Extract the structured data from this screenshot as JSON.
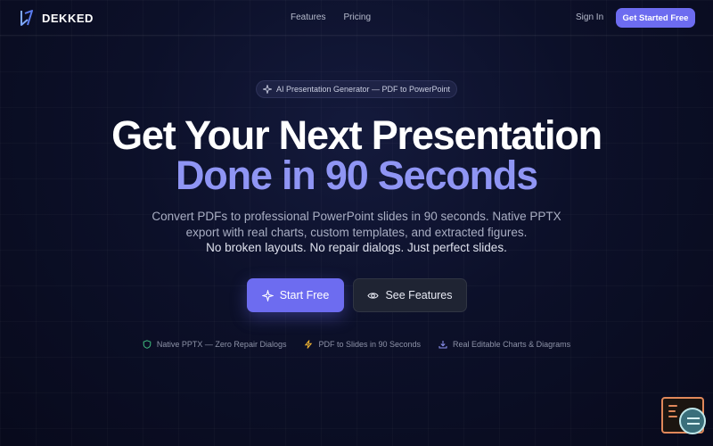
{
  "nav": {
    "brand": "DEKKED",
    "links": [
      "Features",
      "Pricing"
    ],
    "sign_in": "Sign In",
    "cta": "Get Started Free"
  },
  "hero": {
    "badge_icon": "sparkles-icon",
    "badge": "AI Presentation Generator — PDF to PowerPoint",
    "title_line1": "Get Your Next Presentation",
    "title_line2": "Done in 90 Seconds",
    "subtitle": "Convert PDFs to professional PowerPoint slides in 90 seconds. Native PPTX export with real charts, custom templates, and extracted figures.",
    "tagline": "No broken layouts. No repair dialogs. Just perfect slides.",
    "primary_button": "Start Free",
    "secondary_button": "See Features",
    "features": [
      {
        "icon": "shield-icon",
        "label": "Native PPTX — Zero Repair Dialogs"
      },
      {
        "icon": "lightning-icon",
        "label": "PDF to Slides in 90 Seconds"
      },
      {
        "icon": "download-icon",
        "label": "Real Editable Charts & Diagrams"
      }
    ]
  },
  "colors": {
    "accent": "#6d6cf0",
    "headline_accent": "#8f95f4",
    "background": "#0c1029",
    "feature_icons": [
      "#3fbf7f",
      "#f2b632",
      "#8f95f4"
    ]
  }
}
